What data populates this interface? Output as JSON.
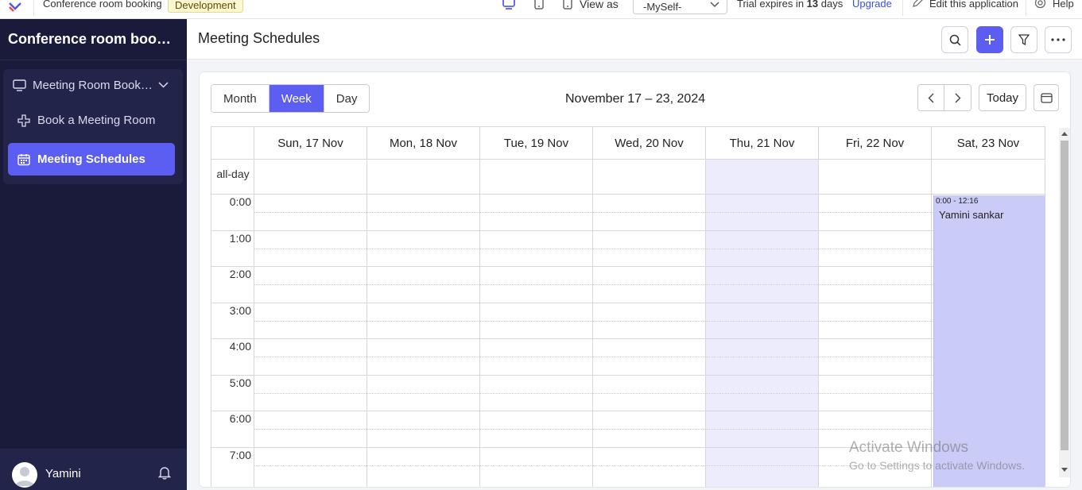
{
  "topbar": {
    "app_name": "Conference room booking",
    "env_badge": "Development",
    "view_as_label": "View as",
    "view_as_value": "-MySelf-",
    "trial_prefix": "Trial expires in",
    "trial_days": "13",
    "trial_suffix": "days",
    "upgrade": "Upgrade",
    "edit_app": "Edit this application",
    "help": "Help"
  },
  "sidebar": {
    "app_title": "Conference room booking",
    "group_label": "Meeting Room Booking",
    "items": [
      {
        "label": "Book a Meeting Room",
        "icon": "plus-icon",
        "active": false
      },
      {
        "label": "Meeting Schedules",
        "icon": "calendar-icon",
        "active": true
      }
    ],
    "user_name": "Yamini"
  },
  "header": {
    "page_title": "Meeting Schedules"
  },
  "calendar": {
    "views": [
      "Month",
      "Week",
      "Day"
    ],
    "active_view": "Week",
    "range_title": "November 17 – 23, 2024",
    "today_label": "Today",
    "all_day_label": "all-day",
    "days": [
      "Sun, 17 Nov",
      "Mon, 18 Nov",
      "Tue, 19 Nov",
      "Wed, 20 Nov",
      "Thu, 21 Nov",
      "Fri, 22 Nov",
      "Sat, 23 Nov"
    ],
    "today_index": 4,
    "time_labels": [
      "0:00",
      "1:00",
      "2:00",
      "3:00",
      "4:00",
      "5:00",
      "6:00",
      "7:00"
    ],
    "event": {
      "time": "0:00 - 12:16",
      "title": "Yamini sankar",
      "day_index": 6,
      "color": "#cbcbf7"
    }
  },
  "watermark": {
    "line1": "Activate Windows",
    "line2": "Go to Settings to activate Windows."
  },
  "colors": {
    "accent": "#5b5ef0",
    "sidebar_bg": "#1a1b3a",
    "today_bg": "#ececfc"
  }
}
